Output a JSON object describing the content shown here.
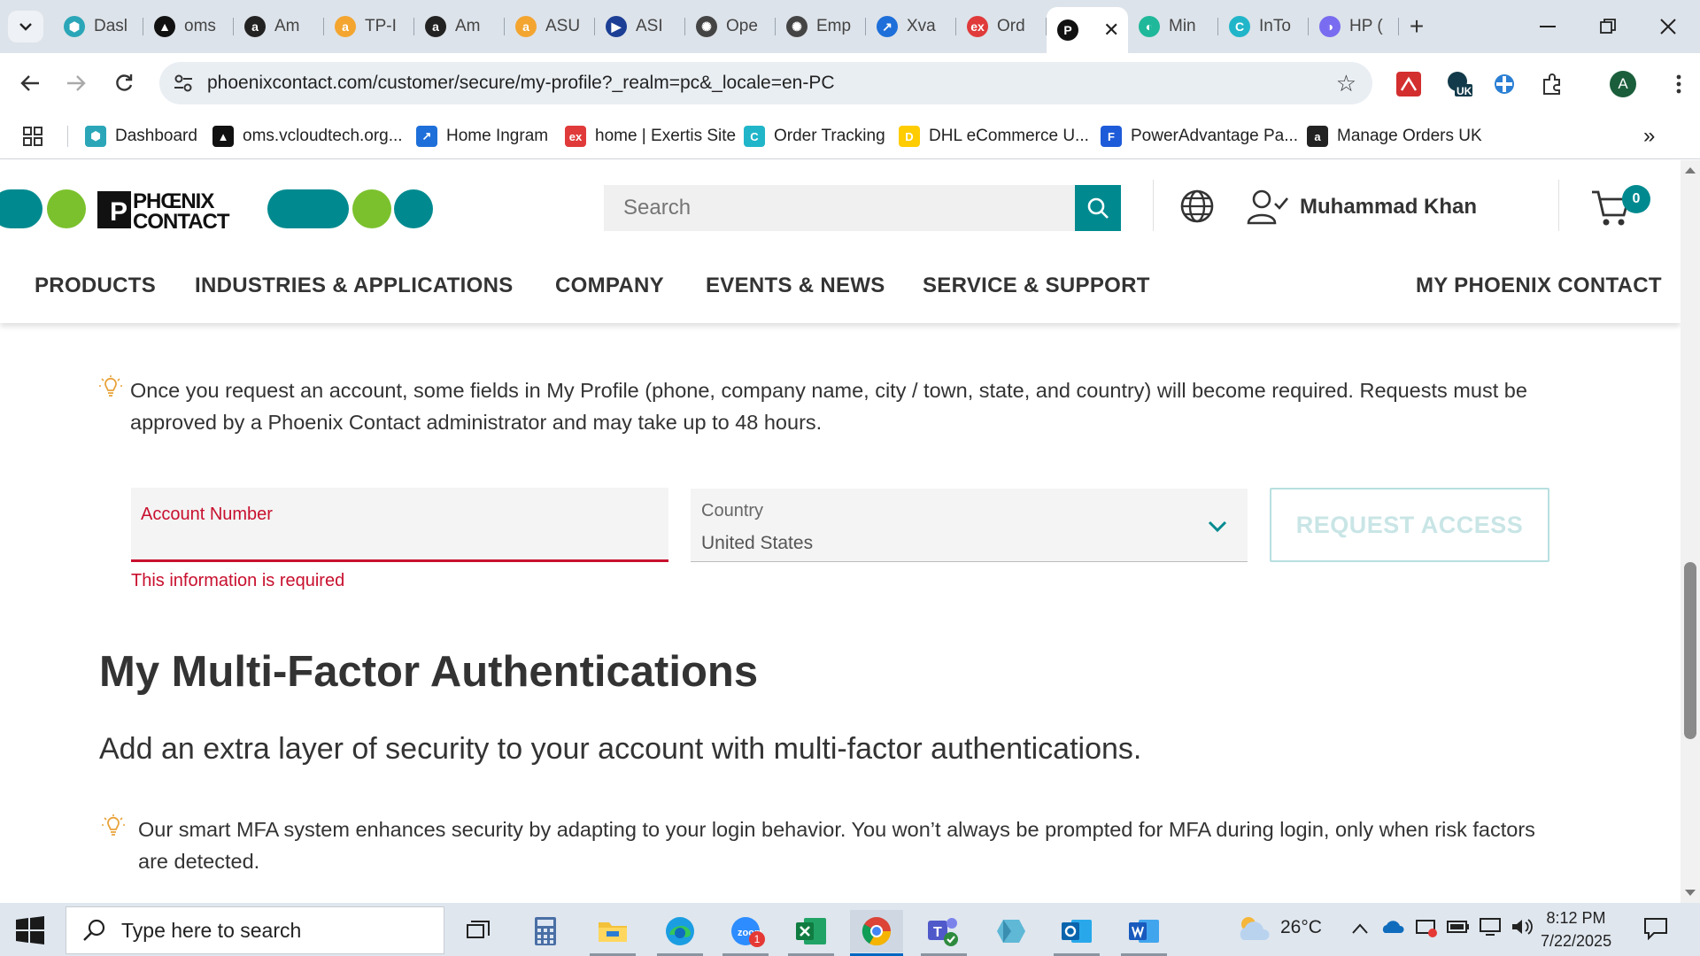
{
  "browser": {
    "tabs": [
      {
        "label": "Dasl",
        "color": "#2aa6b8",
        "glyph": "⬢"
      },
      {
        "label": "oms",
        "color": "#111111",
        "glyph": "▲"
      },
      {
        "label": "Am",
        "color": "#222222",
        "glyph": "a"
      },
      {
        "label": "TP-I",
        "color": "#f3a530",
        "glyph": "a"
      },
      {
        "label": "Am",
        "color": "#222222",
        "glyph": "a"
      },
      {
        "label": "ASU",
        "color": "#f3a530",
        "glyph": "a"
      },
      {
        "label": "ASI",
        "color": "#1c3f95",
        "glyph": "▶"
      },
      {
        "label": "Ope",
        "color": "#444444",
        "glyph": "✺"
      },
      {
        "label": "Emp",
        "color": "#444444",
        "glyph": "✺"
      },
      {
        "label": "Xva",
        "color": "#1e6fd9",
        "glyph": "↗"
      },
      {
        "label": "Ord",
        "color": "#e03a3a",
        "glyph": "ex"
      }
    ],
    "active_tab": {
      "label": "",
      "color": "#111111",
      "glyph": "P"
    },
    "tabs_after": [
      {
        "label": "Min",
        "color": "#1fb89a",
        "glyph": "◐"
      },
      {
        "label": "InTo",
        "color": "#21b5c9",
        "glyph": "C"
      },
      {
        "label": "HP (",
        "color": "#7a6cf0",
        "glyph": "◑"
      }
    ],
    "url": "phoenixcontact.com/customer/secure/my-profile?_realm=pc&_locale=en-PC",
    "profile_initial": "A",
    "ext_badge": "UK",
    "bookmarks": [
      {
        "label": "Dashboard",
        "color": "#2aa6b8",
        "glyph": "⬢"
      },
      {
        "label": "oms.vcloudtech.org...",
        "color": "#111111",
        "glyph": "▲"
      },
      {
        "label": "Home Ingram",
        "color": "#1e6fd9",
        "glyph": "↗"
      },
      {
        "label": "home | Exertis Site",
        "color": "#e03a3a",
        "glyph": "ex"
      },
      {
        "label": "Order Tracking",
        "color": "#21b5c9",
        "glyph": "C"
      },
      {
        "label": "DHL eCommerce U...",
        "color": "#ffcc00",
        "glyph": "D"
      },
      {
        "label": "PowerAdvantage Pa...",
        "color": "#1e5bd9",
        "glyph": "F"
      },
      {
        "label": "Manage Orders UK",
        "color": "#222222",
        "glyph": "a"
      }
    ]
  },
  "header": {
    "search_placeholder": "Search",
    "user_name": "Muhammad Khan",
    "cart_count": "0",
    "nav": [
      "PRODUCTS",
      "INDUSTRIES & APPLICATIONS",
      "COMPANY",
      "EVENTS & NEWS",
      "SERVICE & SUPPORT",
      "MY PHOENIX CONTACT"
    ]
  },
  "account_request": {
    "hint_line1": "Once you request an account, some fields in My Profile (phone, company name, city / town, state, and country) will become required. Requests must be",
    "hint_line2": "approved by a Phoenix Contact administrator and may take up to 48 hours.",
    "account_label": "Account Number",
    "account_value": "",
    "error": "This information is required",
    "country_label": "Country",
    "country_value": "United States",
    "button": "REQUEST ACCESS"
  },
  "mfa": {
    "title": "My Multi-Factor Authentications",
    "subtitle": "Add an extra layer of security to your account with multi-factor authentications.",
    "hint_line1": "Our smart MFA system enhances security by adapting to your login behavior. You won’t always be prompted for MFA during login, only when risk factors",
    "hint_line2": "are detected."
  },
  "taskbar": {
    "search_placeholder": "Type here to search",
    "temperature": "26°C",
    "time": "8:12 PM",
    "date": "7/22/2025",
    "zoom_badge": "1"
  },
  "colors": {
    "brand_teal": "#008a8f",
    "error_red": "#c8102e",
    "logo_green": "#7bc12d"
  }
}
